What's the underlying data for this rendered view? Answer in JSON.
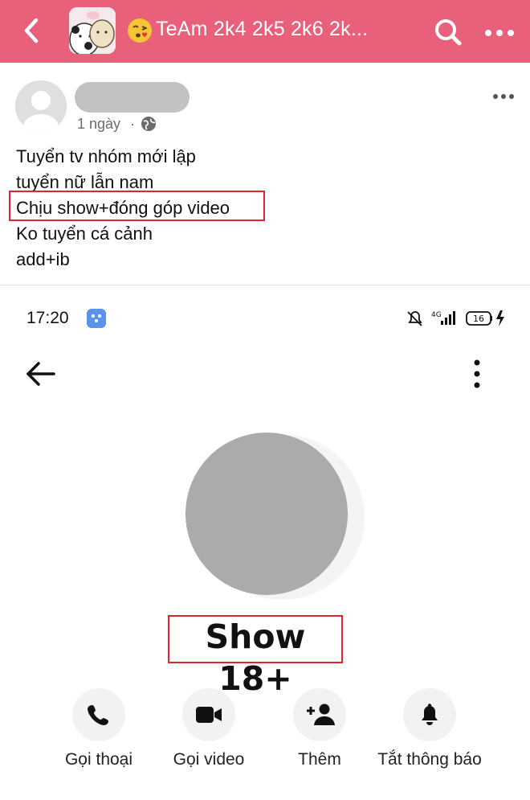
{
  "header": {
    "title": "TeAm 2k4 2k5 2k6 2k...",
    "emoji": "kissing-face-emoji",
    "background": "#e8607a",
    "icons": {
      "back": "back-chevron-icon",
      "search": "search-icon",
      "more": "more-icon"
    }
  },
  "post": {
    "time": "1 ngày",
    "separator": "·",
    "privacy_icon": "globe-icon",
    "lines": [
      "Tuyển tv nhóm mới lập",
      "tuyển nữ lẫn nam",
      "Chịu show+đóng góp video",
      "Ko tuyển cá cảnh",
      "add+ib"
    ]
  },
  "screenshot": {
    "status_time": "17:20",
    "status_right_icons": [
      "mute-bell-icon",
      "4g-signal-icon",
      "battery-icon",
      "charging-icon"
    ],
    "battery_level": "16",
    "network_label": "4G",
    "profile_name": "Show 18+",
    "actions": [
      {
        "label": "Gọi thoại",
        "icon": "phone-icon"
      },
      {
        "label": "Gọi video",
        "icon": "video-camera-icon"
      },
      {
        "label": "Thêm",
        "icon": "add-person-icon"
      },
      {
        "label": "Tắt thông báo",
        "icon": "bell-icon"
      }
    ]
  },
  "colors": {
    "highlight_box": "#e0252f",
    "redacted": "#ababab"
  }
}
